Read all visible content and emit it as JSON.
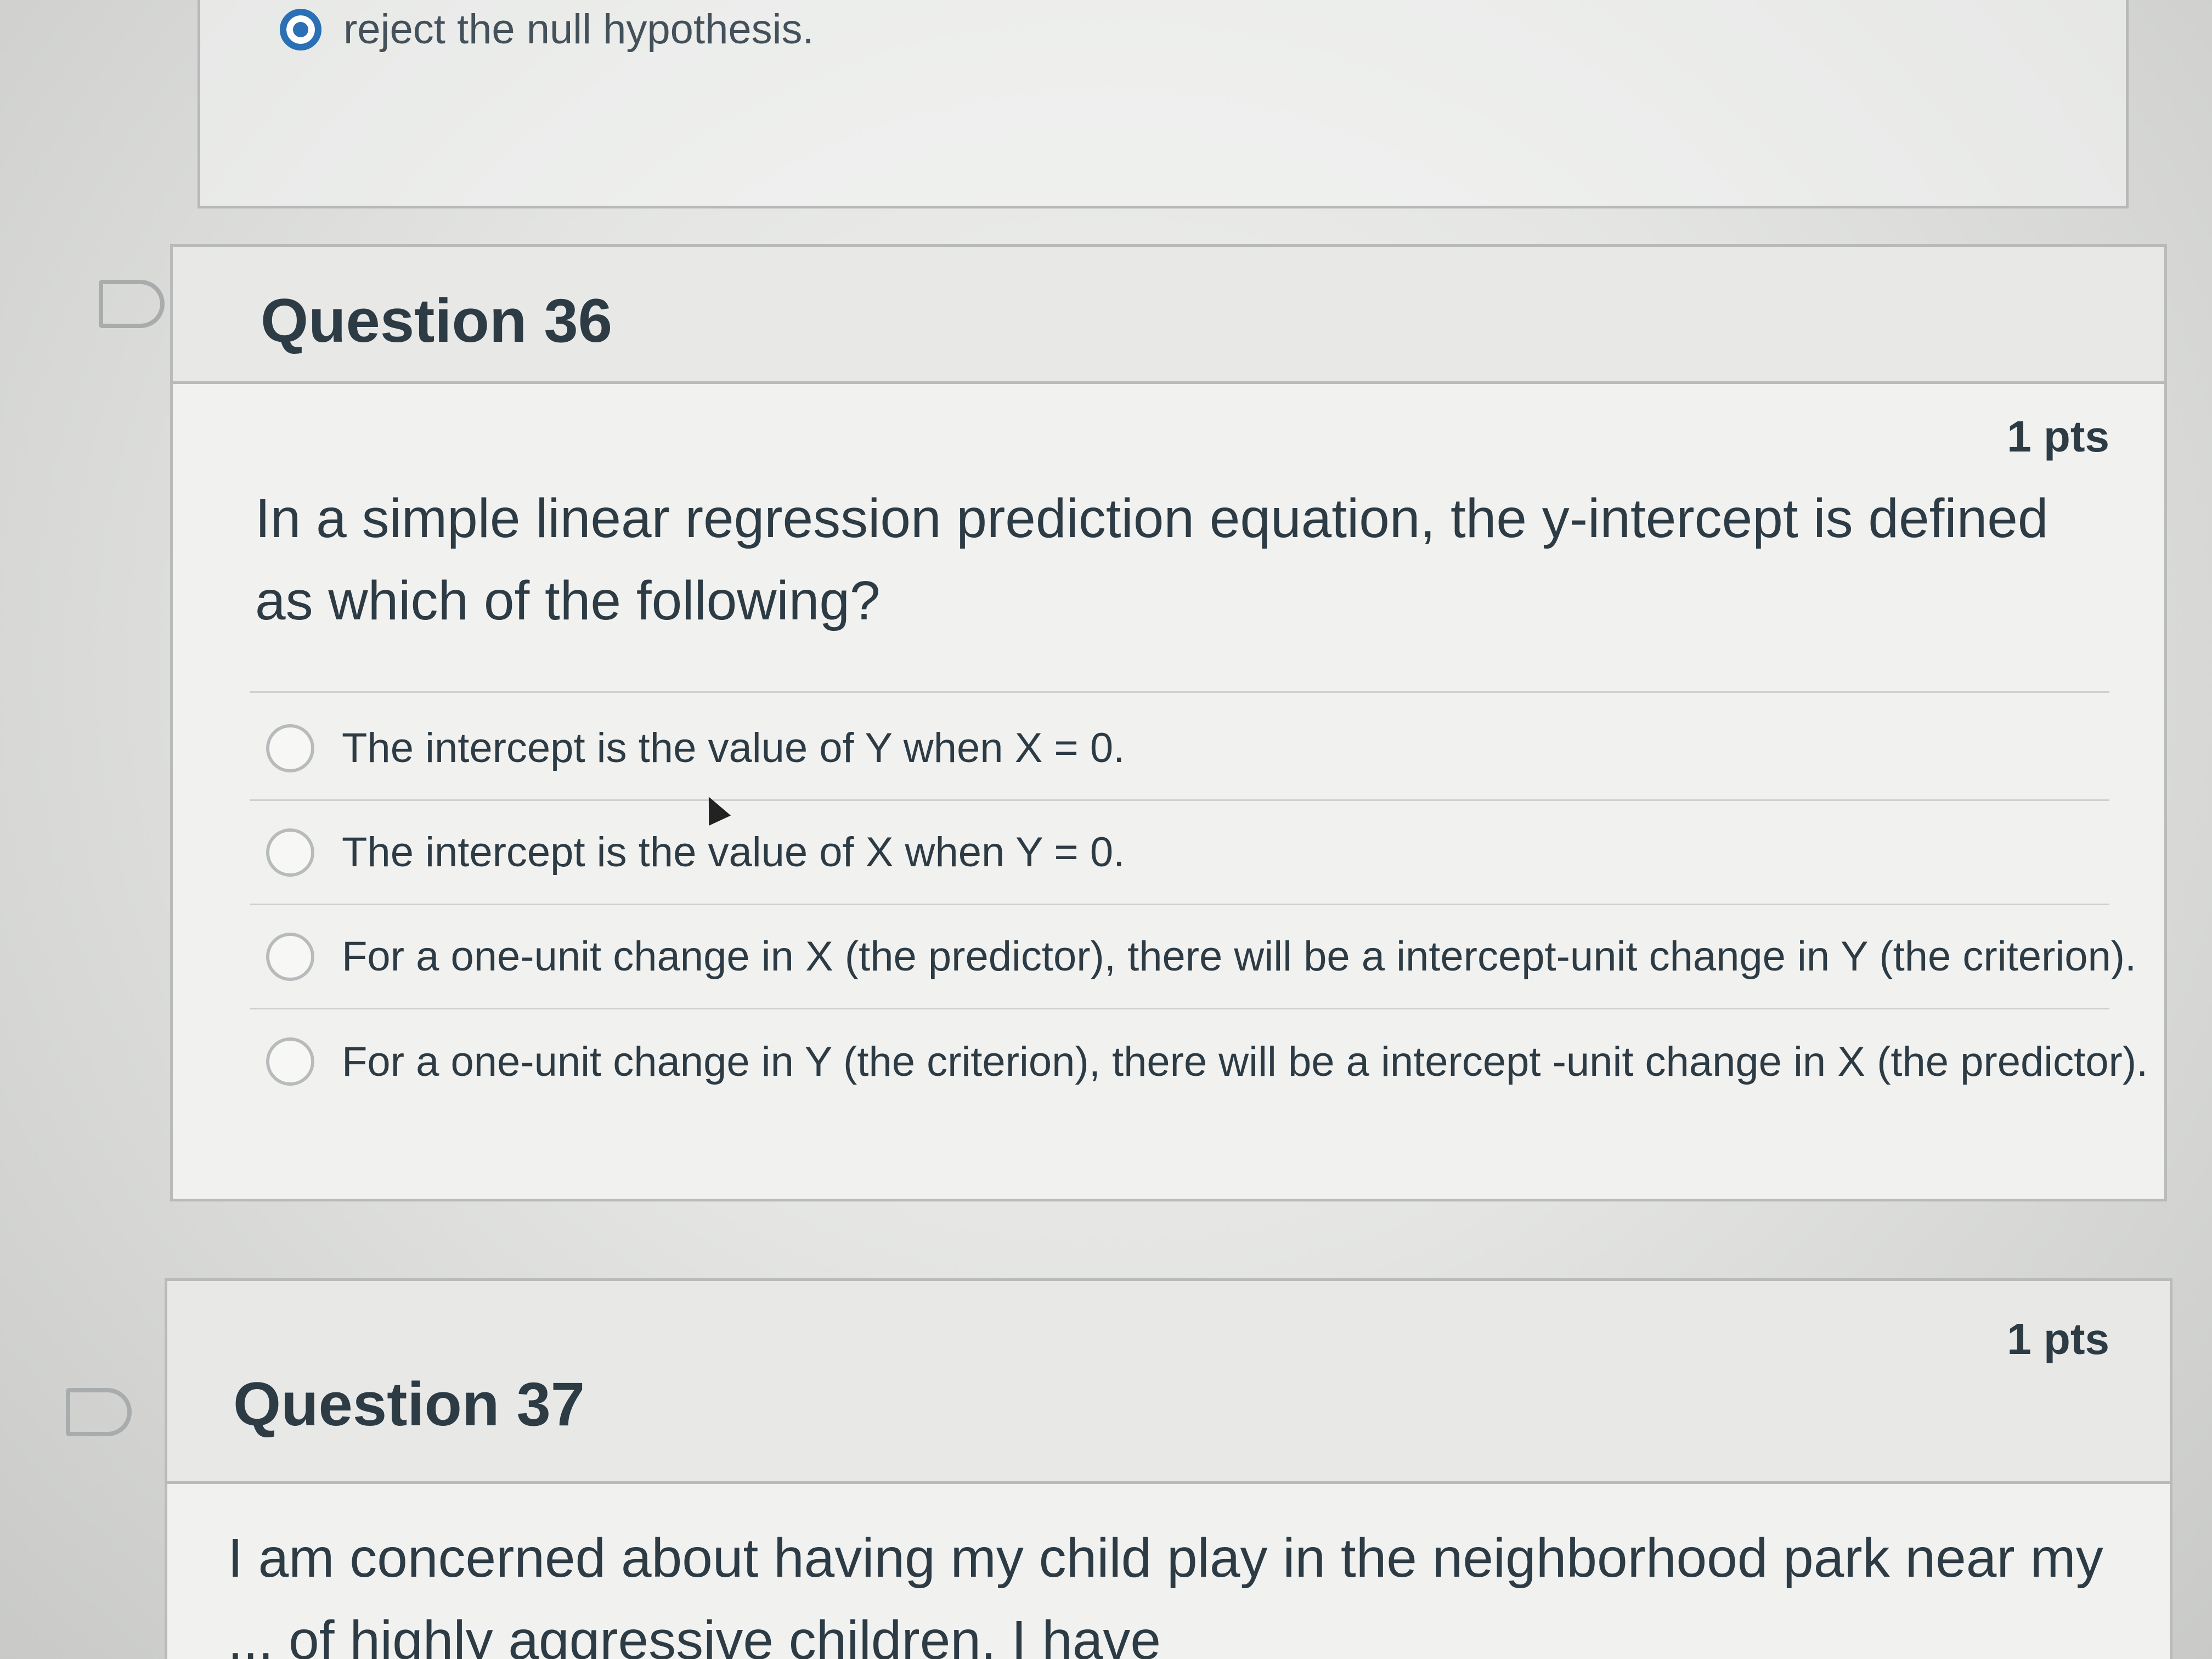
{
  "previous_question": {
    "selected_answer": "reject the null hypothesis."
  },
  "question_36": {
    "title": "Question 36",
    "points": "1 pts",
    "text": "In a simple linear regression prediction equation, the y-intercept is defined as which of the following?",
    "options": [
      "The intercept is the value of Y when X = 0.",
      "The intercept is the value of X when Y = 0.",
      "For a one-unit change in X (the predictor), there will be a intercept-unit change in Y (the criterion).",
      "For a one-unit change in Y (the criterion), there will be a intercept -unit change in X (the predictor)."
    ]
  },
  "question_37": {
    "title": "Question 37",
    "points": "1 pts",
    "text": "I am concerned about having my child play in the neighborhood park near my ... of highly aggressive children. I have"
  },
  "icons": {
    "flag": "flag-icon",
    "radio": "radio-button",
    "cursor": "mouse-pointer-icon"
  },
  "colors": {
    "selected_radio": "#2b6fb5",
    "text": "#2d3b45",
    "border": "#b9bbba"
  }
}
